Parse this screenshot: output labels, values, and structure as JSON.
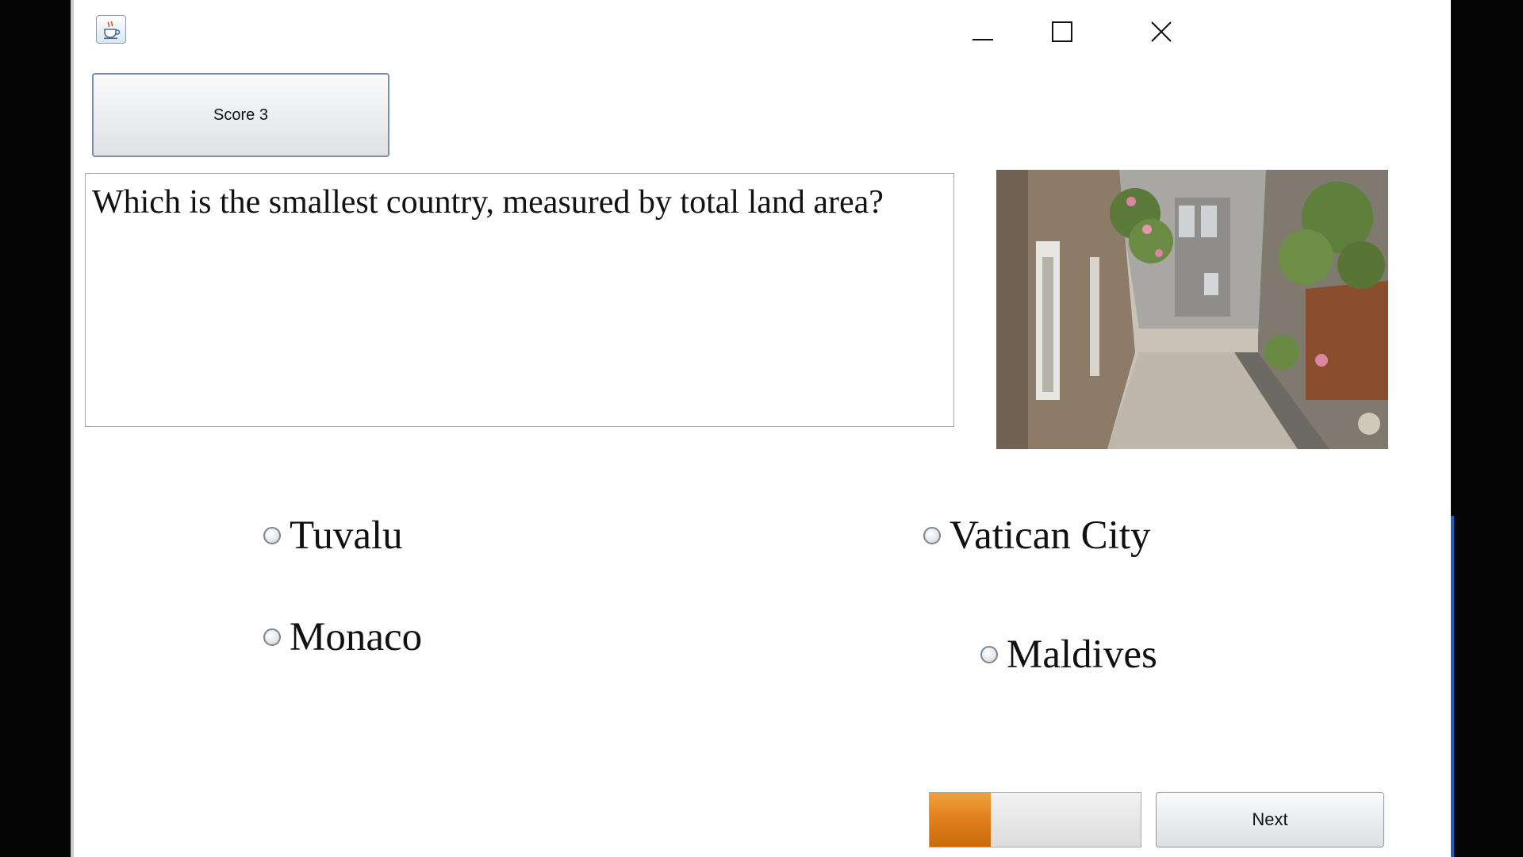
{
  "window": {
    "app_icon": "java-coffee-icon",
    "controls": {
      "minimize_icon": "minimize-icon",
      "maximize_icon": "maximize-icon",
      "close_icon": "close-icon"
    }
  },
  "score": {
    "label": "Score 3"
  },
  "question": {
    "text": "Which is the smallest country, measured by total land area?"
  },
  "image": {
    "subject": "stone-alley-photo"
  },
  "options": [
    {
      "label": "Tuvalu",
      "selected": false
    },
    {
      "label": "Vatican City",
      "selected": false
    },
    {
      "label": "Monaco",
      "selected": false
    },
    {
      "label": "Maldives",
      "selected": false
    }
  ],
  "progress": {
    "value": 0.29,
    "fill_color": "#e07f18"
  },
  "next": {
    "label": "Next"
  },
  "colors": {
    "window_bg": "#ffffff",
    "desktop_bg": "#050505",
    "taskbar_accent": "#1d5fbf"
  }
}
